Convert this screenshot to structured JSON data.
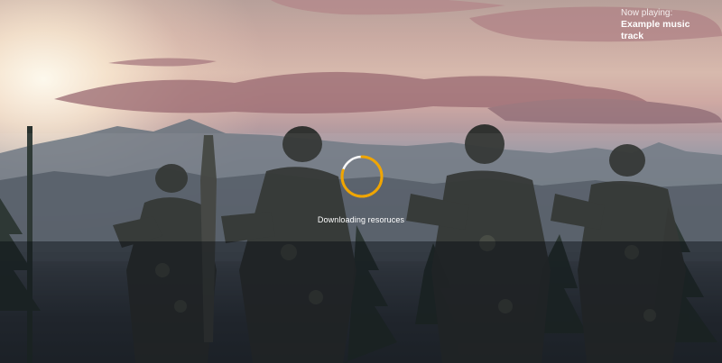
{
  "now_playing": {
    "label": "Now playing:",
    "track": "Example music track"
  },
  "loader": {
    "status": "Downloading resoruces",
    "progress": 0.8,
    "accent_color": "#f0a500",
    "track_color": "#ffffff"
  },
  "icons": {
    "spinner": "loading-ring-icon"
  }
}
